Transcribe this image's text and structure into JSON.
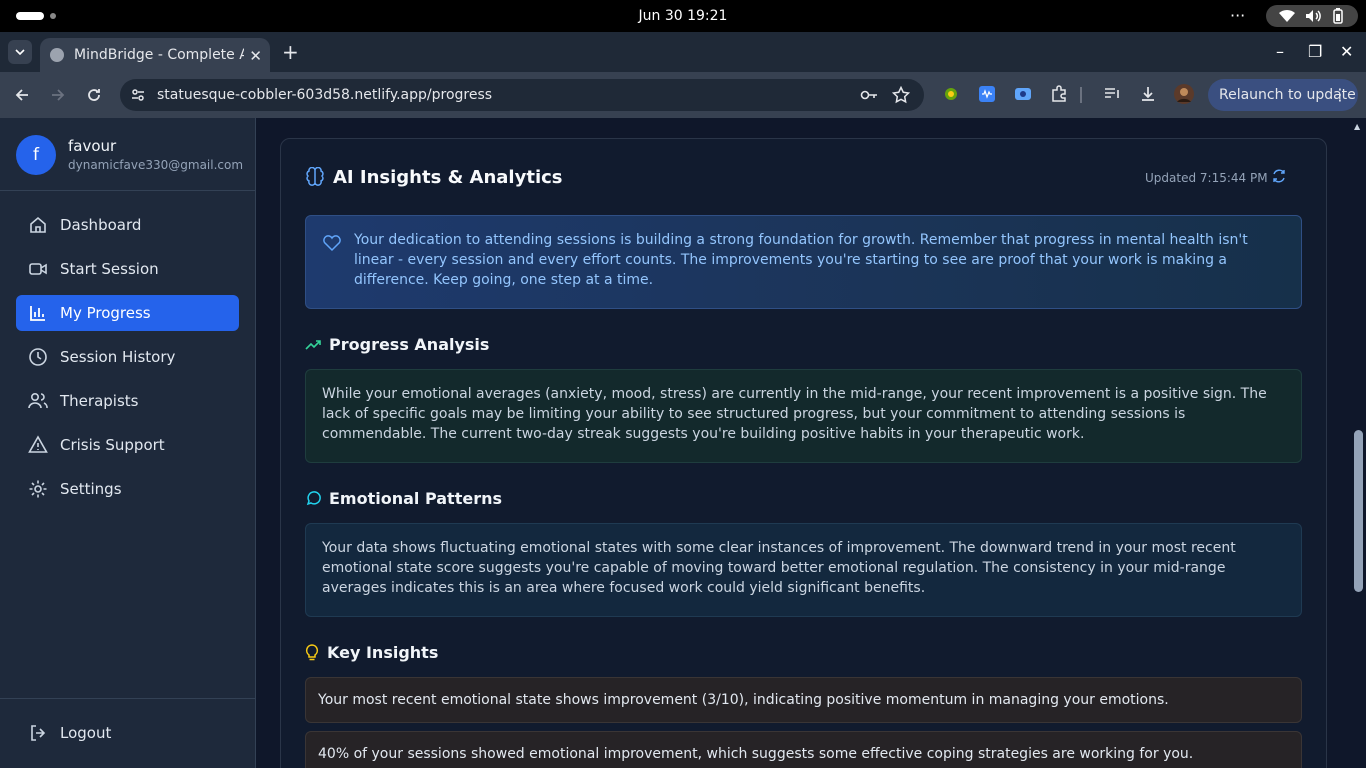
{
  "os": {
    "clock": "Jun 30  19:21",
    "more": "···"
  },
  "browser": {
    "tab_title": "MindBridge - Complete A",
    "url": "statuesque-cobbler-603d58.netlify.app/progress",
    "relaunch_label": "Relaunch to update"
  },
  "profile": {
    "initial": "f",
    "name": "favour",
    "email": "dynamicfave330@gmail.com"
  },
  "sidebar": {
    "items": [
      {
        "label": "Dashboard",
        "icon": "home-icon"
      },
      {
        "label": "Start Session",
        "icon": "video-icon"
      },
      {
        "label": "My Progress",
        "icon": "bar-chart-icon",
        "active": true
      },
      {
        "label": "Session History",
        "icon": "clock-icon"
      },
      {
        "label": "Therapists",
        "icon": "users-icon"
      },
      {
        "label": "Crisis Support",
        "icon": "alert-triangle-icon"
      },
      {
        "label": "Settings",
        "icon": "gear-icon"
      }
    ],
    "logout": "Logout"
  },
  "insights": {
    "title": "AI Insights & Analytics",
    "updated": "Updated 7:15:44 PM",
    "encouragement": "Your dedication to attending sessions is building a strong foundation for growth. Remember that progress in mental health isn't linear - every session and every effort counts. The improvements you're starting to see are proof that your work is making a difference. Keep going, one step at a time.",
    "progress_title": "Progress Analysis",
    "progress_text": "While your emotional averages (anxiety, mood, stress) are currently in the mid-range, your recent improvement is a positive sign. The lack of specific goals may be limiting your ability to see structured progress, but your commitment to attending sessions is commendable. The current two-day streak suggests you're building positive habits in your therapeutic work.",
    "patterns_title": "Emotional Patterns",
    "patterns_text": "Your data shows fluctuating emotional states with some clear instances of improvement. The downward trend in your most recent emotional state score suggests you're capable of moving toward better emotional regulation. The consistency in your mid-range averages indicates this is an area where focused work could yield significant benefits.",
    "key_title": "Key Insights",
    "key_items": [
      "Your most recent emotional state shows improvement (3/10), indicating positive momentum in managing your emotions.",
      "40% of your sessions showed emotional improvement, which suggests some effective coping strategies are working for you."
    ]
  },
  "colors": {
    "accent": "#2563eb",
    "sidebar_bg": "#1e293b",
    "main_bg": "#0f172a"
  }
}
